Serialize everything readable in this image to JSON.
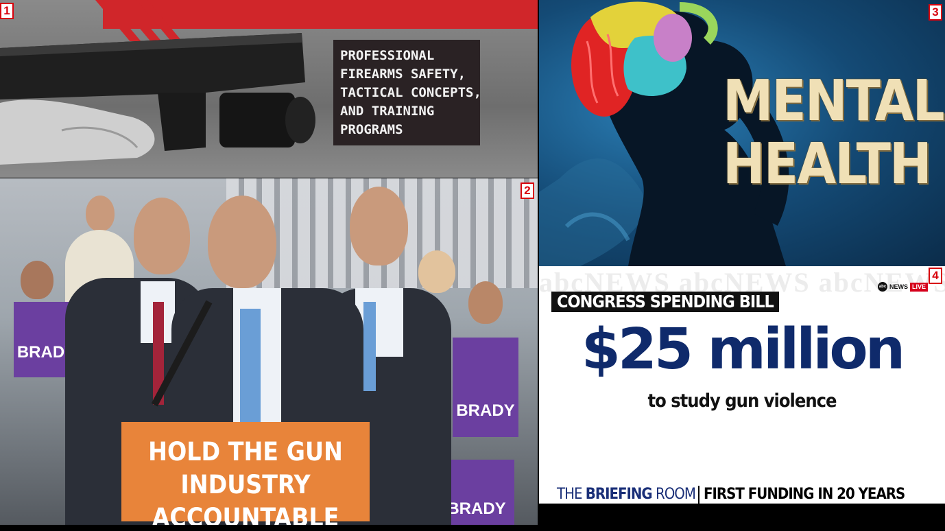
{
  "panel_labels": [
    "1",
    "2",
    "3",
    "4"
  ],
  "panel1": {
    "text_lines": [
      "PROFESSIONAL",
      "FIREARMS SAFETY,",
      "TACTICAL CONCEPTS,",
      "AND TRAINING",
      "PROGRAMS"
    ]
  },
  "panel2": {
    "podium_line1": "HOLD THE GUN",
    "podium_line2_a": "INDUSTRY ",
    "podium_line2_b": "ACCOUNTABLE",
    "sign_brady": "BRADY"
  },
  "panel3": {
    "title_line1": "MENTAL",
    "title_line2": "HEALTH"
  },
  "panel4": {
    "watermark": "abcNEWS abcNEWS abcNEWS",
    "logo_text": "NEWS",
    "logo_dot": "abc",
    "live_badge": "LIVE",
    "kicker": "CONGRESS SPENDING BILL",
    "amount": "$25 million",
    "subtitle": "to study gun violence",
    "lower_third_brand_a": "THE ",
    "lower_third_brand_b": "BRIEFING",
    "lower_third_brand_c": " ROOM",
    "lower_third_headline": "FIRST FUNDING IN 20 YEARS"
  },
  "colors": {
    "red": "#d0262a",
    "podium_orange": "#e8843a",
    "brady_purple": "#6b3fa0",
    "abc_navy": "#0f2a6b",
    "mental_health_gold": "#f0e0b6"
  }
}
